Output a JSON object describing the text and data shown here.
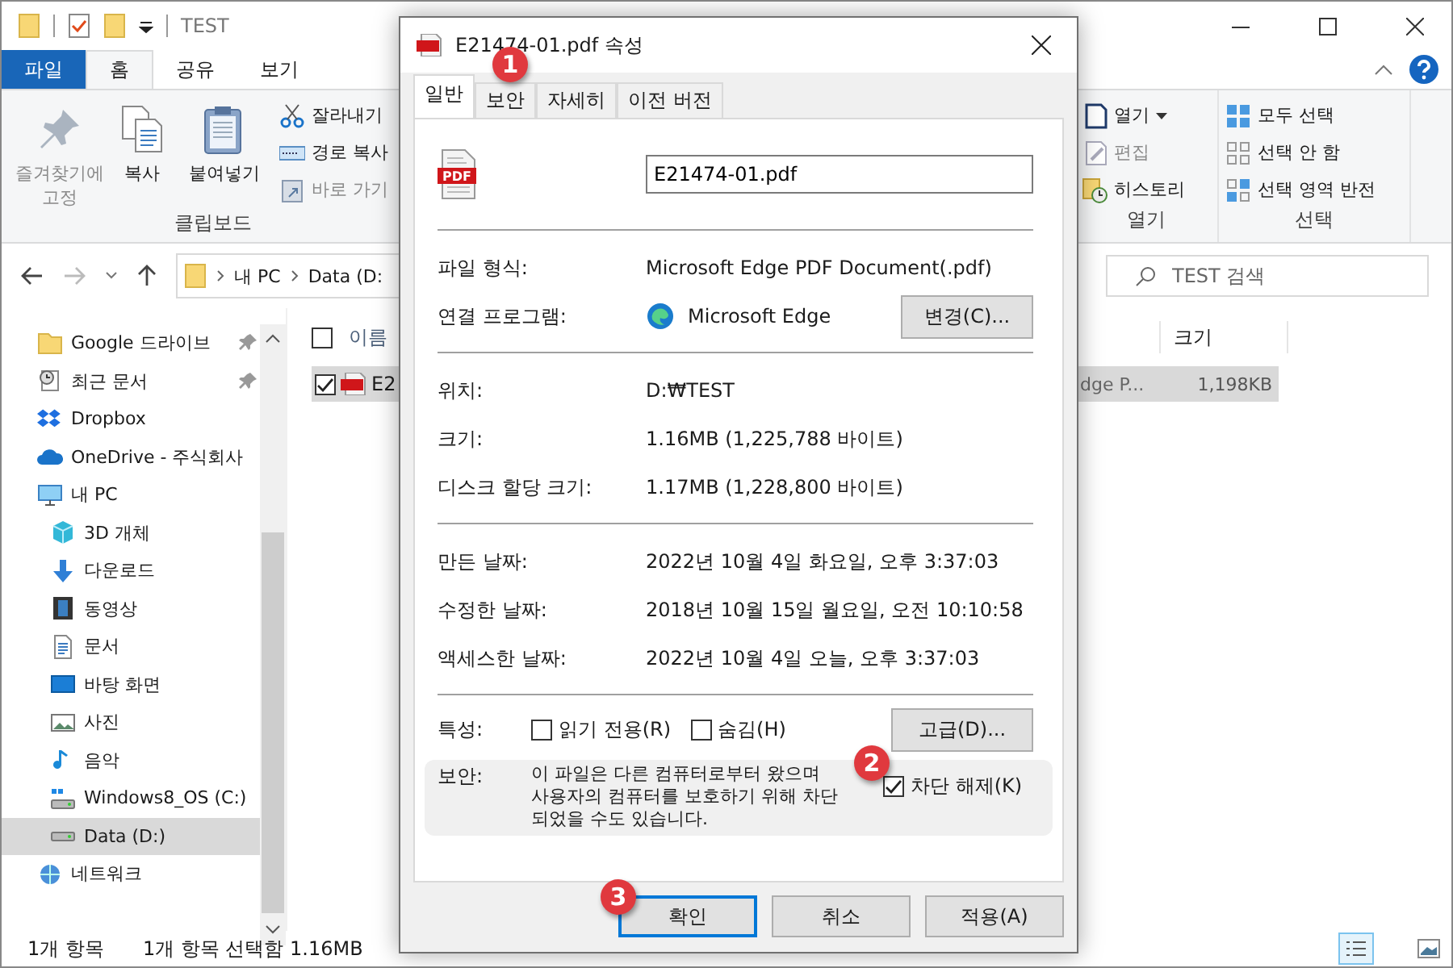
{
  "explorer": {
    "title": "TEST",
    "ribbon_tabs": [
      {
        "label": "파일",
        "kind": "file",
        "selected": false
      },
      {
        "label": "홈",
        "kind": "tab",
        "selected": true
      },
      {
        "label": "공유",
        "kind": "tab",
        "selected": false
      },
      {
        "label": "보기",
        "kind": "tab",
        "selected": false
      }
    ],
    "clipboard_group": {
      "label": "클립보드",
      "large_buttons": [
        {
          "label": "즐겨찾기에 고정",
          "kind": "pin"
        },
        {
          "label": "복사",
          "kind": "copy"
        },
        {
          "label": "붙여넣기",
          "kind": "paste"
        }
      ],
      "small_buttons": [
        {
          "label": "잘라내기",
          "kind": "cut",
          "disabled": false
        },
        {
          "label": "경로 복사",
          "kind": "path",
          "disabled": false
        },
        {
          "label": "바로 가기",
          "kind": "shortcut",
          "disabled": true
        }
      ]
    },
    "open_group": {
      "label": "열기",
      "items": [
        {
          "label": "열기",
          "kind": "open",
          "disabled": false
        },
        {
          "label": "편집",
          "kind": "edit",
          "disabled": true
        },
        {
          "label": "히스토리",
          "kind": "history",
          "disabled": false
        }
      ]
    },
    "select_group": {
      "label": "선택",
      "items": [
        {
          "label": "모두 선택",
          "kind": "all"
        },
        {
          "label": "선택 안 함",
          "kind": "none"
        },
        {
          "label": "선택 영역 반전",
          "kind": "invert"
        }
      ]
    },
    "path": [
      "내 PC",
      "Data (D:"
    ],
    "search": {
      "placeholder": "TEST 검색"
    },
    "sidebar": [
      {
        "label": "Google 드라이브",
        "kind": "folder",
        "pinned": true,
        "selected": false
      },
      {
        "label": "최근 문서",
        "kind": "recent",
        "pinned": true,
        "selected": false
      },
      {
        "label": "Dropbox",
        "kind": "dropbox",
        "pinned": false,
        "selected": false
      },
      {
        "label": "OneDrive - 주식회사",
        "kind": "onedrive",
        "pinned": false,
        "selected": false
      },
      {
        "label": "내 PC",
        "kind": "pc",
        "pinned": false,
        "selected": false,
        "children": [
          {
            "label": "3D 개체",
            "kind": "cube",
            "pinned": false,
            "selected": false
          },
          {
            "label": "다운로드",
            "kind": "download",
            "pinned": false,
            "selected": false
          },
          {
            "label": "동영상",
            "kind": "video",
            "pinned": false,
            "selected": false
          },
          {
            "label": "문서",
            "kind": "doc",
            "pinned": false,
            "selected": false
          },
          {
            "label": "바탕 화면",
            "kind": "desktop",
            "pinned": false,
            "selected": false
          },
          {
            "label": "사진",
            "kind": "pictures",
            "pinned": false,
            "selected": false
          },
          {
            "label": "음악",
            "kind": "music",
            "pinned": false,
            "selected": false
          },
          {
            "label": "Windows8_OS (C:)",
            "kind": "osdrive",
            "pinned": false,
            "selected": false
          },
          {
            "label": "Data (D:)",
            "kind": "drive",
            "pinned": false,
            "selected": true
          }
        ]
      },
      {
        "label": "네트워크",
        "kind": "network",
        "pinned": false,
        "selected": false
      }
    ],
    "columns": [
      {
        "label": "이름",
        "checked": false
      },
      {
        "label": "크기"
      }
    ],
    "rows": [
      {
        "name": "E2",
        "type": "dge P...",
        "size": "1,198KB",
        "selected": true,
        "checked": true
      }
    ],
    "status_bar": [
      "1개 항목",
      "1개 항목 선택함 1.16MB"
    ]
  },
  "dialog": {
    "title": "E21474-01.pdf 속성",
    "tabs": [
      {
        "label": "일반",
        "selected": true
      },
      {
        "label": "보안",
        "selected": false
      },
      {
        "label": "자세히",
        "selected": false
      },
      {
        "label": "이전 버전",
        "selected": false
      }
    ],
    "file_name": "E21474-01.pdf",
    "sections": [
      {
        "rows": [
          {
            "label": "파일 형식:",
            "value": "Microsoft Edge PDF Document(.pdf)",
            "kind": "text"
          },
          {
            "label": "연결 프로그램:",
            "value": "Microsoft Edge",
            "kind": "app",
            "button": "변경(C)..."
          }
        ]
      },
      {
        "rows": [
          {
            "label": "위치:",
            "value": "D:₩TEST",
            "kind": "text"
          },
          {
            "label": "크기:",
            "value": "1.16MB (1,225,788 바이트)",
            "kind": "text"
          },
          {
            "label": "디스크 할당 크기:",
            "value": "1.17MB (1,228,800 바이트)",
            "kind": "text"
          }
        ]
      },
      {
        "rows": [
          {
            "label": "만든 날짜:",
            "value": "2022년 10월 4일 화요일, 오후 3:37:03",
            "kind": "text"
          },
          {
            "label": "수정한 날짜:",
            "value": "2018년 10월 15일 월요일, 오전 10:10:58",
            "kind": "text"
          },
          {
            "label": "액세스한 날짜:",
            "value": "2022년 10월 4일 오늘, 오후 3:37:03",
            "kind": "text"
          }
        ]
      }
    ],
    "attributes": {
      "label": "특성:",
      "checkboxes": [
        {
          "label": "읽기 전용(R)",
          "checked": false
        },
        {
          "label": "숨김(H)",
          "checked": false
        }
      ],
      "button": "고급(D)..."
    },
    "security": {
      "label": "보안:",
      "text": "이 파일은 다른 컴퓨터로부터 왔으며 사용자의 컴퓨터를 보호하기 위해 차단 되었을 수도 있습니다.",
      "checkbox": {
        "label": "차단 해제(K)",
        "checked": true
      }
    },
    "buttons": [
      {
        "label": "확인",
        "focused": true
      },
      {
        "label": "취소",
        "focused": false
      },
      {
        "label": "적용(A)",
        "focused": false
      }
    ]
  },
  "pdf_icon_label": "PDF",
  "callouts": [
    "1",
    "2",
    "3"
  ]
}
